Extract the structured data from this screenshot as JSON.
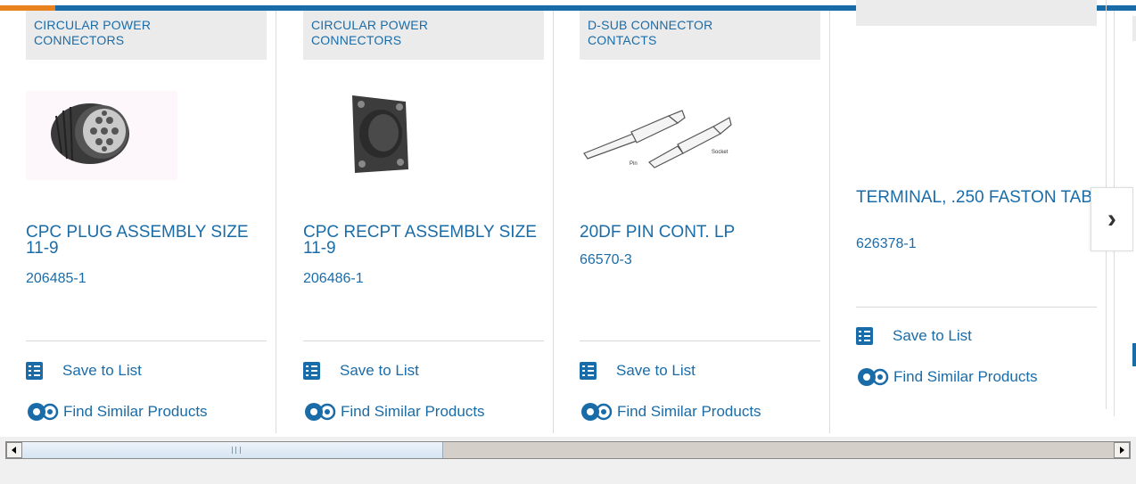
{
  "cards": [
    {
      "category": "CIRCULAR POWER\nCONNECTORS",
      "title": "CPC PLUG ASSEMBLY SIZE 11-9",
      "part_number": "206485-1",
      "save_label": "Save to List",
      "similar_label": "Find Similar Products",
      "image": "circular-plug-image"
    },
    {
      "category": "CIRCULAR POWER\nCONNECTORS",
      "title": "CPC RECPT ASSEMBLY SIZE 11-9",
      "part_number": "206486-1",
      "save_label": "Save to List",
      "similar_label": "Find Similar Products",
      "image": "square-flange-receptacle-image"
    },
    {
      "category": "D-SUB CONNECTOR\nCONTACTS",
      "title": "20DF PIN CONT. LP",
      "part_number": "66570-3",
      "save_label": "Save to List",
      "similar_label": "Find Similar Products",
      "image": "pin-socket-contacts-image",
      "pin_label": "Pin",
      "socket_label": "Socket"
    },
    {
      "category": "",
      "title": "TERMINAL, .250 FASTON TAB",
      "part_number": "626378-1",
      "save_label": "Save to List",
      "similar_label": "Find Similar Products",
      "image": ""
    }
  ],
  "carousel": {
    "next_icon": "chevron-right-icon"
  },
  "colors": {
    "link": "#1a6ca8",
    "accent": "#e8821e",
    "category_bg": "#ebebeb"
  }
}
